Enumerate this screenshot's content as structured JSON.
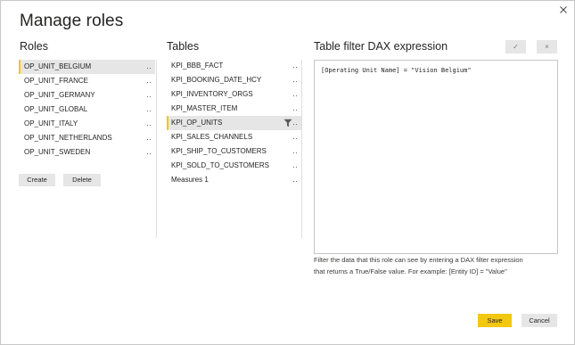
{
  "dialog": {
    "title": "Manage roles"
  },
  "roles": {
    "header": "Roles",
    "items": [
      {
        "label": "OP_UNIT_BELGIUM",
        "more": "..",
        "selected": true
      },
      {
        "label": "OP_UNIT_FRANCE",
        "more": ".."
      },
      {
        "label": "OP_UNIT_GERMANY",
        "more": ".."
      },
      {
        "label": "OP_UNIT_GLOBAL",
        "more": ".."
      },
      {
        "label": "OP_UNIT_ITALY",
        "more": ".."
      },
      {
        "label": "OP_UNIT_NETHERLANDS",
        "more": ".."
      },
      {
        "label": "OP_UNIT_SWEDEN",
        "more": ".."
      }
    ],
    "create_label": "Create",
    "delete_label": "Delete"
  },
  "tables": {
    "header": "Tables",
    "items": [
      {
        "label": "KPI_BBB_FACT",
        "more": ".."
      },
      {
        "label": "KPI_BOOKING_DATE_HCY",
        "more": ".."
      },
      {
        "label": "KPI_INVENTORY_ORGS",
        "more": ".."
      },
      {
        "label": "KPI_MASTER_ITEM",
        "more": ".."
      },
      {
        "label": "KPI_OP_UNITS",
        "more": "..",
        "selected": true,
        "filter_icon": "filter-icon"
      },
      {
        "label": "KPI_SALES_CHANNELS",
        "more": ".."
      },
      {
        "label": "KPI_SHIP_TO_CUSTOMERS",
        "more": ".."
      },
      {
        "label": "KPI_SOLD_TO_CUSTOMERS",
        "more": ".."
      },
      {
        "label": "Measures 1",
        "more": ".."
      }
    ]
  },
  "dax": {
    "header": "Table filter DAX expression",
    "check_icon": "✓",
    "discard_icon": "×",
    "expression": "[Operating Unit Name] = \"Vision Belgium\"",
    "help_line1": "Filter the data that this role can see by entering a DAX filter expression",
    "help_line2": "that returns a True/False value. For example: [Entity ID] = \"Value\""
  },
  "footer": {
    "save_label": "Save",
    "cancel_label": "Cancel"
  },
  "colors": {
    "accent": "#F2C811",
    "selected_row": "#E6E6E6",
    "button": "#E6E6E6"
  }
}
